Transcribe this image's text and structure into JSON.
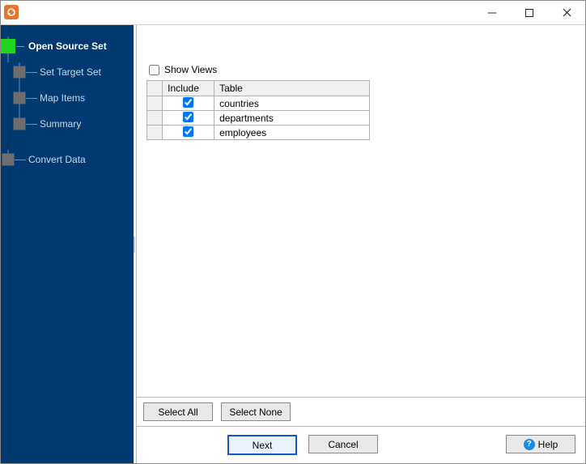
{
  "title": "",
  "sidebar": {
    "steps": [
      {
        "label": "Open Source Set",
        "active": true
      },
      {
        "label": "Set Target Set",
        "active": false
      },
      {
        "label": "Map Items",
        "active": false
      },
      {
        "label": "Summary",
        "active": false
      },
      {
        "label": "Convert Data",
        "active": false
      }
    ]
  },
  "main": {
    "show_views_label": "Show Views",
    "show_views_checked": false,
    "columns": {
      "include": "Include",
      "table": "Table"
    },
    "rows": [
      {
        "include": true,
        "table": "countries"
      },
      {
        "include": true,
        "table": "departments"
      },
      {
        "include": true,
        "table": "employees"
      }
    ],
    "select_all": "Select All",
    "select_none": "Select None"
  },
  "footer": {
    "next": "Next",
    "cancel": "Cancel",
    "help": "Help"
  },
  "window_controls": {
    "minimize": "Minimize",
    "maximize": "Maximize",
    "close": "Close"
  }
}
